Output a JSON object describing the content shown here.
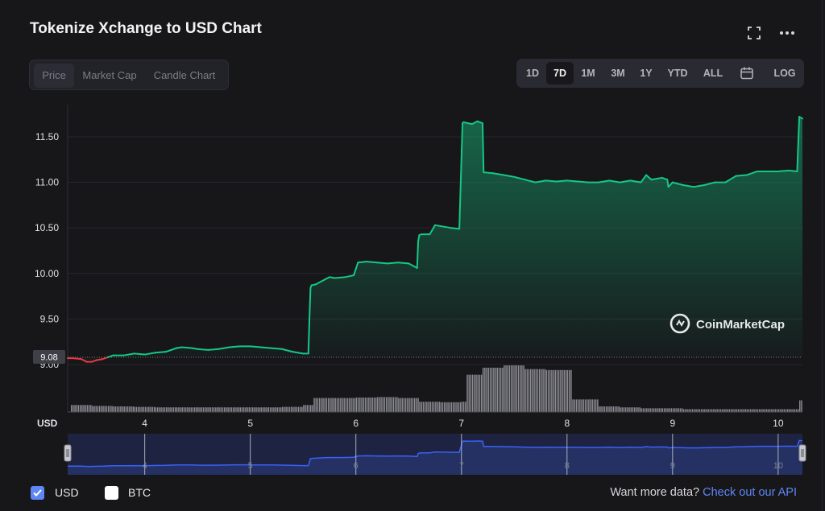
{
  "header": {
    "title": "Tokenize Xchange to USD Chart"
  },
  "icons": {
    "fullscreen": "fullscreen-icon",
    "more": "more-icon",
    "calendar": "calendar-icon",
    "logo": "coinmarketcap-logo-icon"
  },
  "tabs": [
    {
      "label": "Price",
      "active": true
    },
    {
      "label": "Market Cap",
      "active": false
    },
    {
      "label": "Candle Chart",
      "active": false
    }
  ],
  "ranges": [
    {
      "label": "1D",
      "active": false
    },
    {
      "label": "7D",
      "active": true
    },
    {
      "label": "1M",
      "active": false
    },
    {
      "label": "3M",
      "active": false
    },
    {
      "label": "1Y",
      "active": false
    },
    {
      "label": "YTD",
      "active": false
    },
    {
      "label": "ALL",
      "active": false
    },
    {
      "label": "LOG",
      "active": false
    }
  ],
  "chart_data": {
    "type": "area",
    "title": "",
    "xlabel": "",
    "ylabel": "",
    "y_unit": "USD",
    "watermark": "CoinMarketCap",
    "current_price_label": "9.08",
    "reference_price": 9.08,
    "ylim": [
      9.0,
      11.75
    ],
    "y_ticks": [
      {
        "v": 9.0,
        "label": "9.00"
      },
      {
        "v": 9.5,
        "label": "9.50"
      },
      {
        "v": 10.0,
        "label": "10.00"
      },
      {
        "v": 10.5,
        "label": "10.50"
      },
      {
        "v": 11.0,
        "label": "11.00"
      },
      {
        "v": 11.5,
        "label": "11.50"
      }
    ],
    "xlim": [
      3.27,
      10.23
    ],
    "x_ticks": [
      {
        "v": 4,
        "label": "4"
      },
      {
        "v": 5,
        "label": "5"
      },
      {
        "v": 6,
        "label": "6"
      },
      {
        "v": 7,
        "label": "7"
      },
      {
        "v": 8,
        "label": "8"
      },
      {
        "v": 9,
        "label": "9"
      },
      {
        "v": 10,
        "label": "10"
      }
    ],
    "colors": {
      "up": "#16c784",
      "down": "#ea3943",
      "navigator": "#3861fb"
    },
    "series": [
      {
        "x": [
          3.27,
          3.32,
          3.4,
          3.45,
          3.5,
          3.55,
          3.6,
          3.65,
          3.7,
          3.8,
          3.9,
          4.0,
          4.1,
          4.2,
          4.3,
          4.35,
          4.45,
          4.5,
          4.6,
          4.7,
          4.8,
          4.9,
          5.0,
          5.1,
          5.2,
          5.3,
          5.4,
          5.5,
          5.55,
          5.56,
          5.57,
          5.58,
          5.62,
          5.7,
          5.75,
          5.8,
          5.9,
          5.98,
          6.0,
          6.02,
          6.1,
          6.2,
          6.3,
          6.4,
          6.5,
          6.58,
          6.59,
          6.6,
          6.62,
          6.7,
          6.75,
          6.8,
          6.9,
          6.98,
          7.01,
          7.02,
          7.1,
          7.15,
          7.2,
          7.21,
          7.3,
          7.4,
          7.5,
          7.6,
          7.7,
          7.8,
          7.9,
          8.0,
          8.1,
          8.2,
          8.3,
          8.4,
          8.5,
          8.6,
          8.7,
          8.75,
          8.8,
          8.9,
          8.95,
          8.96,
          9.0,
          9.1,
          9.2,
          9.3,
          9.4,
          9.5,
          9.6,
          9.7,
          9.8,
          9.9,
          10.0,
          10.1,
          10.18,
          10.2,
          10.23
        ],
        "y": [
          9.07,
          9.07,
          9.06,
          9.03,
          9.03,
          9.05,
          9.06,
          9.08,
          9.1,
          9.1,
          9.12,
          9.11,
          9.13,
          9.14,
          9.18,
          9.19,
          9.18,
          9.17,
          9.16,
          9.17,
          9.19,
          9.2,
          9.2,
          9.19,
          9.18,
          9.17,
          9.14,
          9.12,
          9.12,
          9.5,
          9.84,
          9.87,
          9.88,
          9.93,
          9.96,
          9.95,
          9.96,
          9.98,
          10.05,
          10.12,
          10.13,
          10.12,
          10.11,
          10.12,
          10.11,
          10.06,
          10.35,
          10.42,
          10.43,
          10.43,
          10.53,
          10.52,
          10.5,
          10.49,
          11.65,
          11.66,
          11.64,
          11.67,
          11.65,
          11.11,
          11.1,
          11.08,
          11.06,
          11.03,
          11.0,
          11.02,
          11.01,
          11.02,
          11.01,
          11.0,
          11.0,
          11.02,
          11.0,
          11.02,
          11.0,
          11.08,
          11.03,
          11.05,
          11.03,
          10.95,
          11.0,
          10.97,
          10.95,
          10.97,
          11.0,
          11.0,
          11.07,
          11.08,
          11.12,
          11.12,
          11.12,
          11.13,
          11.12,
          11.72,
          11.7
        ]
      }
    ],
    "volume": {
      "x": [
        3.3,
        3.5,
        3.7,
        3.9,
        4.1,
        4.3,
        4.5,
        4.7,
        4.9,
        5.1,
        5.3,
        5.5,
        5.6,
        5.8,
        6.0,
        6.2,
        6.4,
        6.6,
        6.8,
        7.0,
        7.05,
        7.2,
        7.4,
        7.6,
        7.8,
        8.0,
        8.05,
        8.3,
        8.5,
        8.7,
        8.9,
        9.1,
        9.3,
        9.5,
        9.7,
        9.9,
        10.1,
        10.2
      ],
      "rel": [
        0.15,
        0.13,
        0.12,
        0.11,
        0.1,
        0.1,
        0.1,
        0.1,
        0.1,
        0.1,
        0.11,
        0.15,
        0.3,
        0.3,
        0.31,
        0.32,
        0.3,
        0.22,
        0.21,
        0.22,
        0.8,
        0.95,
        1.0,
        0.92,
        0.9,
        0.9,
        0.27,
        0.12,
        0.1,
        0.08,
        0.08,
        0.06,
        0.06,
        0.06,
        0.06,
        0.06,
        0.06,
        0.25
      ]
    }
  },
  "footer": {
    "legend": [
      {
        "label": "USD",
        "checked": true
      },
      {
        "label": "BTC",
        "checked": false
      }
    ],
    "more_text": "Want more data?",
    "more_link": "Check out our API"
  }
}
